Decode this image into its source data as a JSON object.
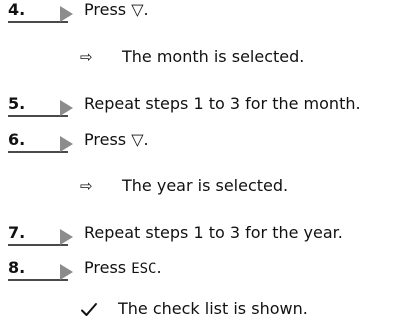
{
  "steps": [
    {
      "number": "4.",
      "prefix": "Press",
      "symbol": "▽",
      "suffix": ".",
      "result_icon": "arrow-right-outline-icon",
      "result_icon_glyph": "⇨",
      "result": "The month is selected."
    },
    {
      "number": "5.",
      "text": "Repeat steps 1 to 3 for the month."
    },
    {
      "number": "6.",
      "prefix": "Press",
      "symbol": "▽",
      "suffix": ".",
      "result_icon": "arrow-right-outline-icon",
      "result_icon_glyph": "⇨",
      "result": "The year is selected."
    },
    {
      "number": "7.",
      "text": "Repeat steps 1 to 3 for the year."
    },
    {
      "number": "8.",
      "prefix": "Press",
      "key": "ESC",
      "suffix": "."
    }
  ],
  "final_result": {
    "icon": "checkmark-icon",
    "text": "The check list is shown."
  }
}
